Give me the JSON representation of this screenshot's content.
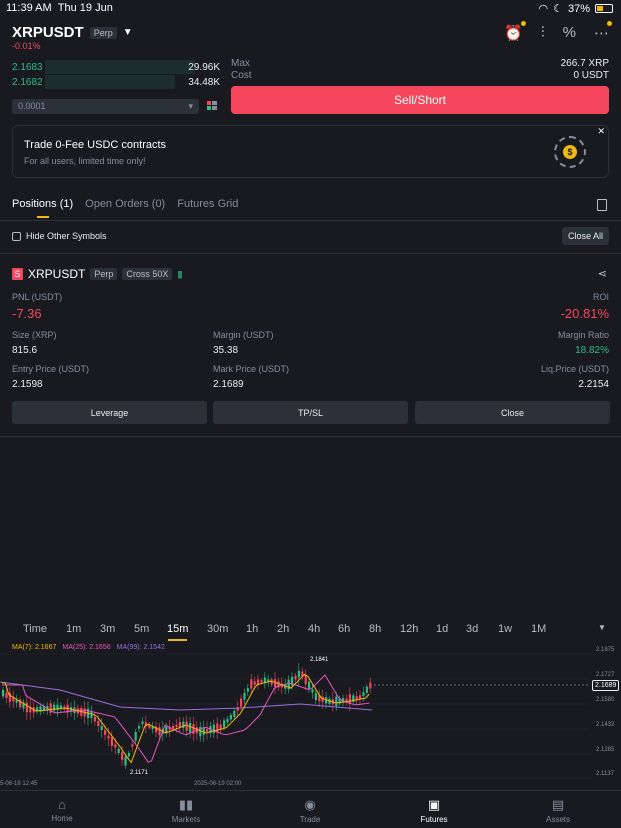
{
  "status_bar": {
    "time": "11:39 AM",
    "date": "Thu 19 Jun",
    "battery": "37%"
  },
  "header": {
    "symbol": "XRPUSDT",
    "contract_type": "Perp",
    "change": "-0.01%"
  },
  "order_book": {
    "rows": [
      {
        "price": "2.1683",
        "amount": "29.96K"
      },
      {
        "price": "2.1682",
        "amount": "34.48K"
      }
    ],
    "precision": "0.0001"
  },
  "order_form": {
    "max_label": "Max",
    "max_value": "266.7 XRP",
    "cost_label": "Cost",
    "cost_value": "0 USDT",
    "sell_button": "Sell/Short"
  },
  "banner": {
    "title": "Trade 0-Fee USDC contracts",
    "subtitle": "For all users, limited time only!"
  },
  "tabs": [
    "Positions (1)",
    "Open Orders (0)",
    "Futures Grid"
  ],
  "filters": {
    "hide_other": "Hide Other Symbols",
    "close_all": "Close All"
  },
  "position": {
    "side_badge": "S",
    "symbol": "XRPUSDT",
    "type": "Perp",
    "margin_mode": "Cross 50X",
    "pnl_label": "PNL (USDT)",
    "pnl": "-7.36",
    "roi_label": "ROI",
    "roi": "-20.81%",
    "size_label": "Size (XRP)",
    "size": "815.6",
    "margin_label": "Margin (USDT)",
    "margin": "35.38",
    "margin_ratio_label": "Margin Ratio",
    "margin_ratio": "18.82%",
    "entry_label": "Entry Price (USDT)",
    "entry": "2.1598",
    "mark_label": "Mark Price (USDT)",
    "mark": "2.1689",
    "liq_label": "Liq.Price (USDT)",
    "liq": "2.2154",
    "buttons": {
      "leverage": "Leverage",
      "tpsl": "TP/SL",
      "close": "Close"
    }
  },
  "chart": {
    "timeframes": [
      "Time",
      "1m",
      "3m",
      "5m",
      "15m",
      "30m",
      "1h",
      "2h",
      "4h",
      "6h",
      "8h",
      "12h",
      "1d",
      "3d",
      "1w",
      "1M"
    ],
    "active_timeframe": "15m",
    "ma7": "MA(7): 2.1667",
    "ma25": "MA(25): 2.1656",
    "ma99": "MA(99): 2.1542",
    "y_ticks": [
      "2.1875",
      "2.1727",
      "2.1580",
      "2.1432",
      "2.1285",
      "2.1137"
    ],
    "current_price": "2.1689",
    "high_label": "2.1841",
    "low_label": "2.1171",
    "x_labels": [
      "5-06-18 12:45",
      "2025-06-19 02:00"
    ],
    "colors": {
      "up": "#2ebd85",
      "down": "#f6465d",
      "ma7": "#f0b90b",
      "ma25": "#e754c5",
      "ma99": "#9b6ee0"
    }
  },
  "nav": {
    "items": [
      {
        "label": "Home",
        "icon": "home-icon"
      },
      {
        "label": "Markets",
        "icon": "markets-icon"
      },
      {
        "label": "Trade",
        "icon": "trade-icon"
      },
      {
        "label": "Futures",
        "icon": "futures-icon"
      },
      {
        "label": "Assets",
        "icon": "assets-icon"
      }
    ],
    "active": "Futures"
  }
}
